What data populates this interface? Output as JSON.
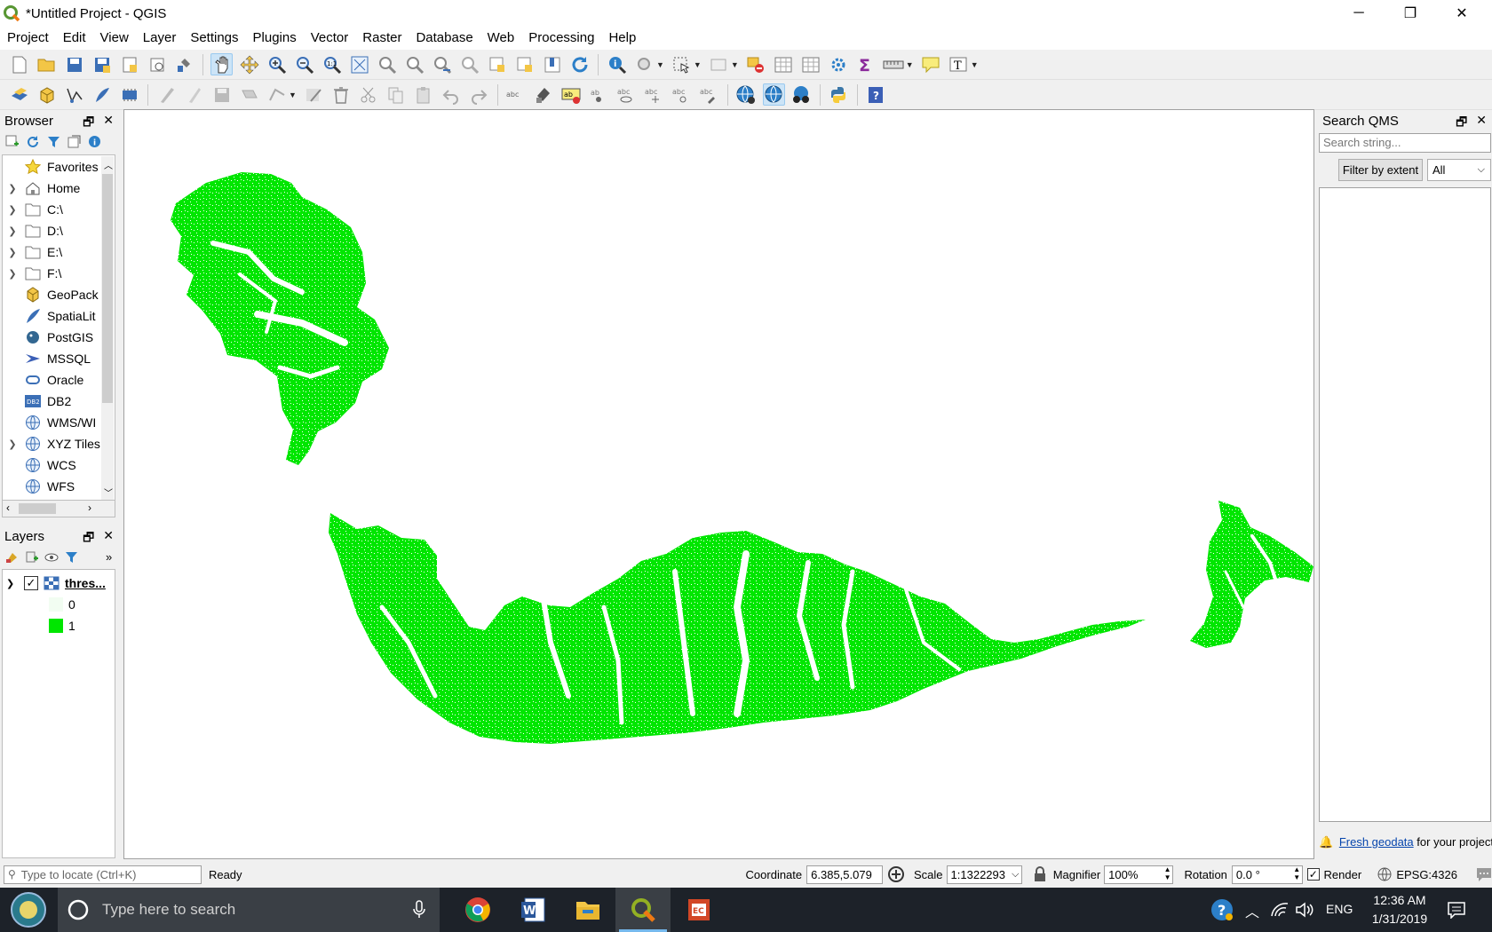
{
  "window": {
    "title": "*Untitled Project - QGIS",
    "minimize": "─",
    "restore": "❐",
    "close": "✕"
  },
  "menu": [
    "Project",
    "Edit",
    "View",
    "Layer",
    "Settings",
    "Plugins",
    "Vector",
    "Raster",
    "Database",
    "Web",
    "Processing",
    "Help"
  ],
  "browser": {
    "title": "Browser",
    "items": [
      {
        "label": "Favorites",
        "icon": "star-icon",
        "expandable": false
      },
      {
        "label": "Home",
        "icon": "home-icon",
        "expandable": true
      },
      {
        "label": "C:\\",
        "icon": "folder-icon",
        "expandable": true
      },
      {
        "label": "D:\\",
        "icon": "folder-icon",
        "expandable": true
      },
      {
        "label": "E:\\",
        "icon": "folder-icon",
        "expandable": true
      },
      {
        "label": "F:\\",
        "icon": "folder-icon",
        "expandable": true
      },
      {
        "label": "GeoPack",
        "icon": "geopackage-icon",
        "expandable": false
      },
      {
        "label": "SpatiaLit",
        "icon": "spatialite-icon",
        "expandable": false
      },
      {
        "label": "PostGIS",
        "icon": "postgis-icon",
        "expandable": false
      },
      {
        "label": "MSSQL",
        "icon": "mssql-icon",
        "expandable": false
      },
      {
        "label": "Oracle",
        "icon": "oracle-icon",
        "expandable": false
      },
      {
        "label": "DB2",
        "icon": "db2-icon",
        "expandable": false
      },
      {
        "label": "WMS/WI",
        "icon": "globe-icon",
        "expandable": false
      },
      {
        "label": "XYZ Tiles",
        "icon": "globe-icon",
        "expandable": true
      },
      {
        "label": "WCS",
        "icon": "globe-icon",
        "expandable": false
      },
      {
        "label": "WFS",
        "icon": "globe-icon",
        "expandable": false
      }
    ]
  },
  "layers": {
    "title": "Layers",
    "layer_name": "thres...",
    "legend": [
      {
        "value": "0",
        "color": "#f2fdf2"
      },
      {
        "value": "1",
        "color": "#00e600"
      }
    ]
  },
  "map": {
    "fill_color": "#00e600"
  },
  "qms": {
    "title": "Search QMS",
    "search_placeholder": "Search string...",
    "filter_button": "Filter by extent",
    "filter_select": "All",
    "footer_link": "Fresh geodata",
    "footer_text": "for your project"
  },
  "status": {
    "locate_placeholder": "Type to locate (Ctrl+K)",
    "ready": "Ready",
    "coordinate_label": "Coordinate",
    "coordinate_value": "6.385,5.079",
    "scale_label": "Scale",
    "scale_value": "1:1322293",
    "magnifier_label": "Magnifier",
    "magnifier_value": "100%",
    "rotation_label": "Rotation",
    "rotation_value": "0.0 °",
    "render_label": "Render",
    "crs": "EPSG:4326"
  },
  "taskbar": {
    "search_placeholder": "Type here to search",
    "language": "ENG",
    "time": "12:36 AM",
    "date": "1/31/2019"
  }
}
